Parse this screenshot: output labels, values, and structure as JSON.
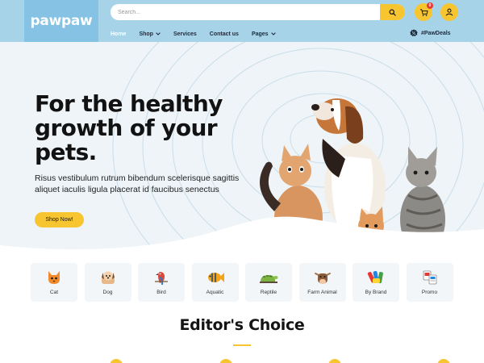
{
  "brand": {
    "logo_text": "pawpaw"
  },
  "search": {
    "placeholder": "Search...",
    "icon": "search-icon"
  },
  "header_actions": {
    "cart_icon": "cart-icon",
    "cart_count": "0",
    "user_icon": "user-icon"
  },
  "nav": {
    "items": [
      {
        "label": "Home",
        "active": true
      },
      {
        "label": "Shop",
        "dropdown": true
      },
      {
        "label": "Services"
      },
      {
        "label": "Contact us"
      },
      {
        "label": "Pages",
        "dropdown": true
      }
    ],
    "deals": {
      "label": "#PawDeals",
      "icon": "percent-badge-icon"
    }
  },
  "hero": {
    "title": "For the healthy growth of your pets.",
    "description": "Risus vestibulum rutrum bibendum scelerisque sagittis aliquet iaculis ligula placerat id faucibus senectus",
    "cta_label": "Shop Now!"
  },
  "categories": [
    {
      "label": "Cat",
      "icon": "cat-icon"
    },
    {
      "label": "Dog",
      "icon": "dog-icon"
    },
    {
      "label": "Bird",
      "icon": "bird-icon"
    },
    {
      "label": "Aquatic",
      "icon": "fish-icon"
    },
    {
      "label": "Reptile",
      "icon": "reptile-icon"
    },
    {
      "label": "Farm Animal",
      "icon": "cow-icon"
    },
    {
      "label": "By Brand",
      "icon": "brand-icon"
    },
    {
      "label": "Promo",
      "icon": "promo-icon"
    }
  ],
  "editors_choice": {
    "title": "Editor's Choice"
  },
  "colors": {
    "header_bg": "#a7d3e9",
    "logo_bg": "#86c2e3",
    "accent": "#f7c530",
    "hero_bg": "#eef4f8",
    "card_bg": "#f3f6f9"
  }
}
